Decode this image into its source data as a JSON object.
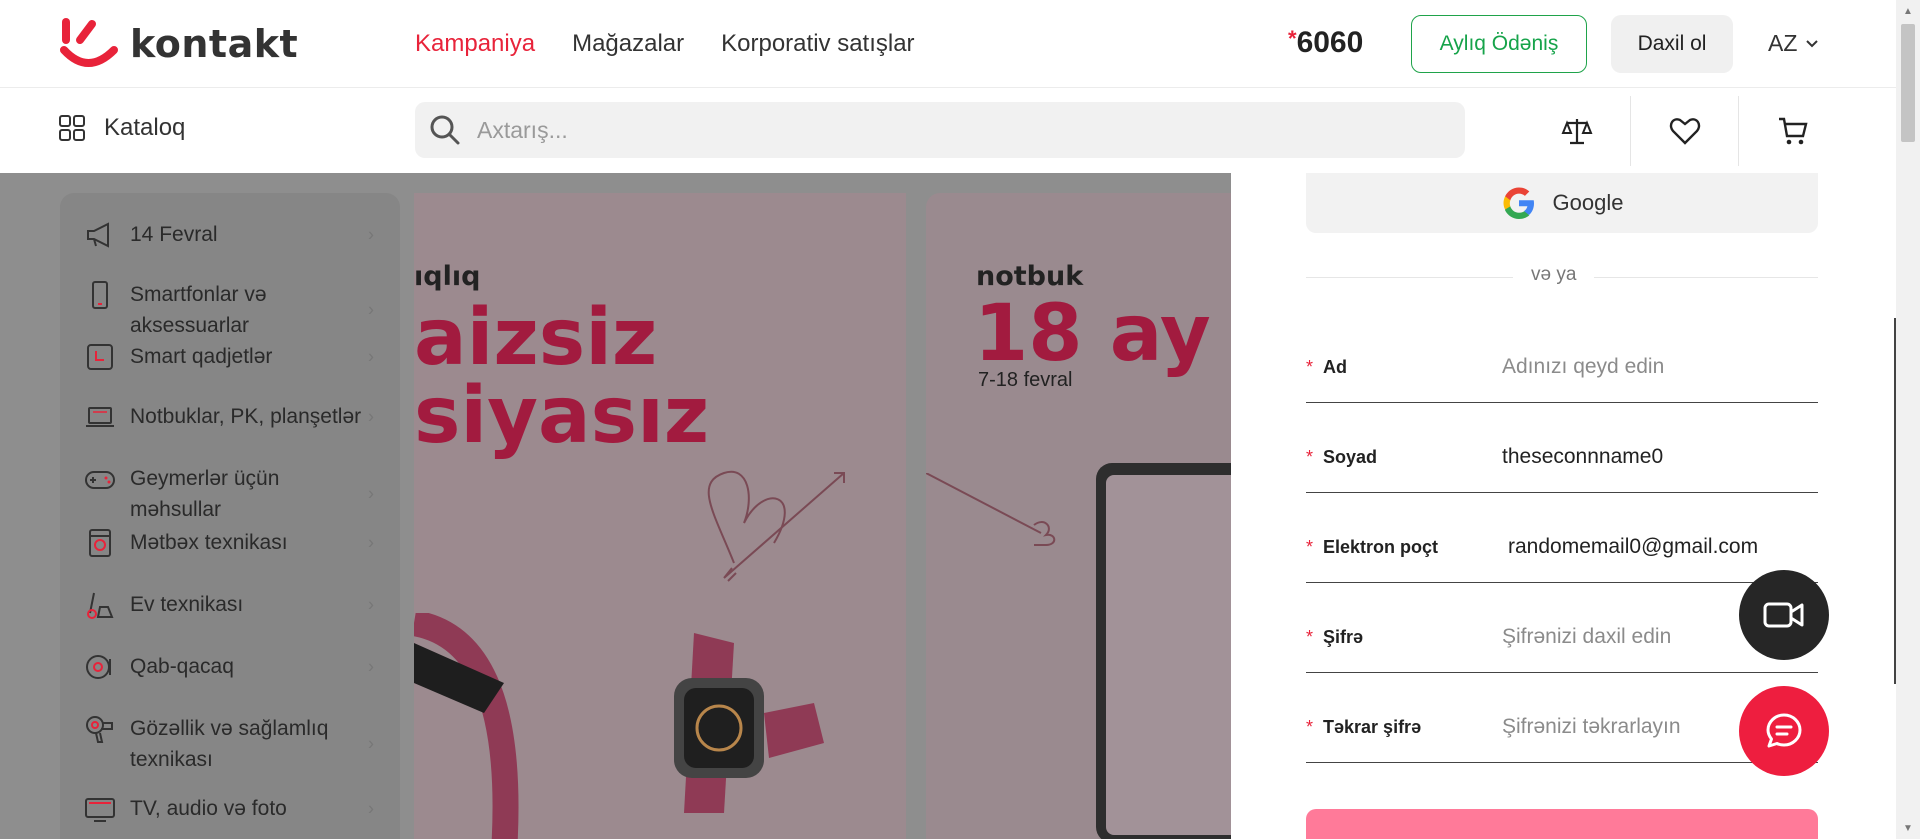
{
  "header": {
    "logo_text": "kontakt",
    "nav": [
      {
        "label": "Kampaniya",
        "active": true
      },
      {
        "label": "Mağazalar",
        "active": false
      },
      {
        "label": "Korporativ satışlar",
        "active": false
      }
    ],
    "phone_star": "*",
    "phone": "6060",
    "monthly_payment_label": "Aylıq Ödəniş",
    "login_label": "Daxil ol",
    "language": "AZ"
  },
  "subheader": {
    "catalog_label": "Kataloq",
    "search_placeholder": "Axtarış...",
    "tools": [
      "compare-icon",
      "heart-icon",
      "cart-icon"
    ]
  },
  "category_menu": {
    "items": [
      {
        "label": "14 Fevral",
        "icon": "megaphone-icon"
      },
      {
        "label": "Smartfonlar və aksessuarlar",
        "icon": "smartphone-icon"
      },
      {
        "label": "Smart qadjetlər",
        "icon": "smartwatch-icon"
      },
      {
        "label": "Notbuklar, PK, planşetlər",
        "icon": "laptop-icon"
      },
      {
        "label": "Geymerlər üçün məhsullar",
        "icon": "gamepad-icon"
      },
      {
        "label": "Mətbəx texnikası",
        "icon": "oven-icon"
      },
      {
        "label": "Ev texnikası",
        "icon": "vacuum-icon"
      },
      {
        "label": "Qab-qacaq",
        "icon": "cookware-icon"
      },
      {
        "label": "Gözəllik və sağlamlıq texnikası",
        "icon": "hairdryer-icon"
      },
      {
        "label": "TV, audio və foto",
        "icon": "tv-icon"
      }
    ]
  },
  "banners": [
    {
      "line1": "ıqlıq",
      "line2": "aizsiz",
      "line3": "siyasız"
    },
    {
      "line1": "notbuk",
      "line2": "18 ay",
      "date": "7-18 fevral"
    }
  ],
  "register_form": {
    "google_label": "Google",
    "or_label": "və ya",
    "required_mark": "*",
    "fields": [
      {
        "label": "Ad",
        "value": "",
        "placeholder": "Adınızı qeyd edin"
      },
      {
        "label": "Soyad",
        "value": "theseconnname0",
        "placeholder": ""
      },
      {
        "label": "Elektron poçt",
        "value": "randomemail0@gmail.com",
        "placeholder": ""
      },
      {
        "label": "Şifrə",
        "value": "",
        "placeholder": "Şifrənizi daxil edin"
      },
      {
        "label": "Təkrar şifrə",
        "value": "",
        "placeholder": "Şifrənizi təkrarlayın"
      }
    ]
  },
  "colors": {
    "brand_red": "#e8233a",
    "green": "#16a34a",
    "submit_pink": "#ff7a99",
    "dark_fab": "#262626"
  }
}
